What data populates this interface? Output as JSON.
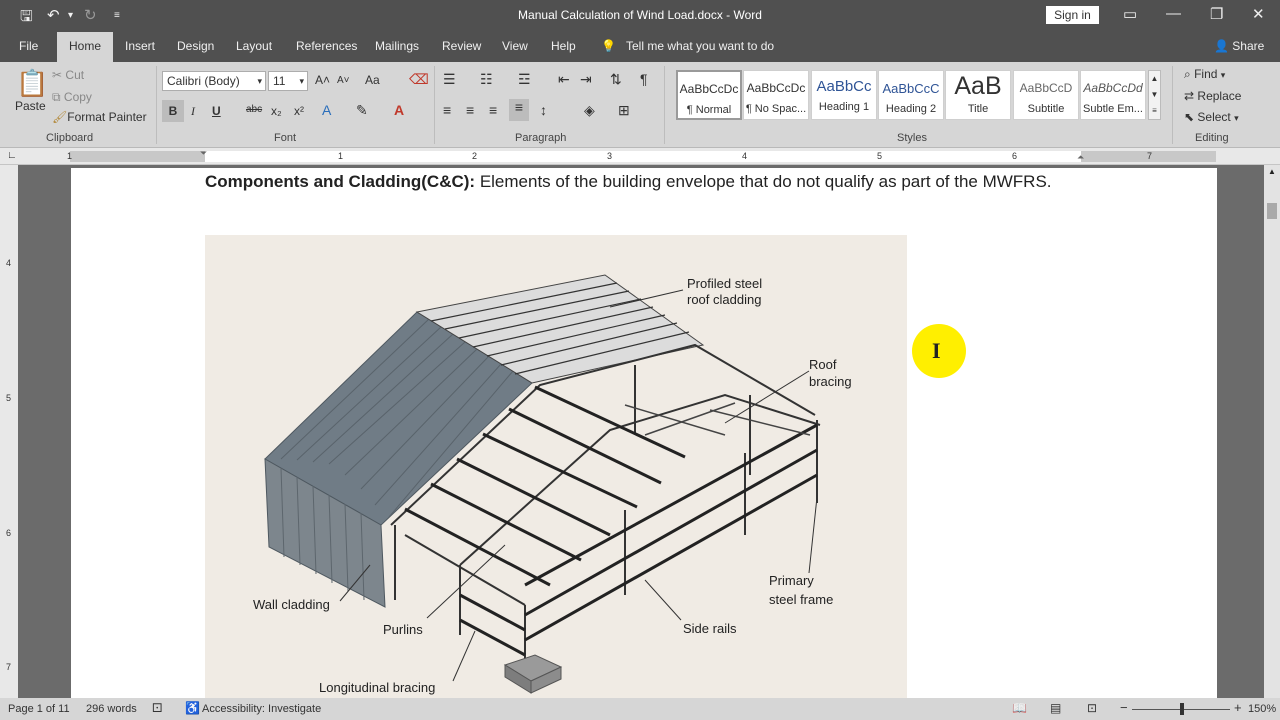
{
  "titlebar": {
    "save_icon": "save-icon",
    "undo_icon": "undo-icon",
    "redo_icon": "redo-icon",
    "title": "Manual Calculation of Wind Load.docx  -  Word",
    "signin": "Sign in"
  },
  "tabs": [
    "File",
    "Home",
    "Insert",
    "Design",
    "Layout",
    "References",
    "Mailings",
    "Review",
    "View",
    "Help",
    "Tell me what you want to do",
    "Share"
  ],
  "clipboard": {
    "paste": "Paste",
    "cut": "Cut",
    "copy": "Copy",
    "format_painter": "Format Painter",
    "group": "Clipboard"
  },
  "font": {
    "name": "Calibri (Body)",
    "size": "11",
    "group": "Font",
    "bold": "B",
    "italic": "I",
    "underline": "U",
    "strike": "abc",
    "sub": "x₂",
    "sup": "x²",
    "grow": "A˄",
    "shrink": "A˅",
    "case": "Aa"
  },
  "paragraph": {
    "group": "Paragraph"
  },
  "styles": {
    "group": "Styles",
    "items": [
      {
        "sample": "AaBbCcDc",
        "name": "¶ Normal"
      },
      {
        "sample": "AaBbCcDc",
        "name": "¶ No Spac..."
      },
      {
        "sample": "AaBbCc",
        "name": "Heading 1"
      },
      {
        "sample": "AaBbCcC",
        "name": "Heading 2"
      },
      {
        "sample": "AaB",
        "name": "Title"
      },
      {
        "sample": "AaBbCcD",
        "name": "Subtitle"
      },
      {
        "sample": "AaBbCcDd",
        "name": "Subtle Em..."
      }
    ]
  },
  "editing": {
    "find": "Find",
    "replace": "Replace",
    "select": "Select",
    "group": "Editing"
  },
  "ruler": {
    "numbers": [
      "1",
      "1",
      "2",
      "3",
      "4",
      "5",
      "6",
      "7"
    ],
    "vnumbers": [
      "4",
      "5",
      "6",
      "7"
    ]
  },
  "document": {
    "heading_bold": "Components and Cladding(C&C):",
    "heading_rest": " Elements of the building envelope that do not qualify as part of the MWFRS."
  },
  "figure": {
    "labels": [
      "Profiled steel",
      "roof cladding",
      "Roof",
      "bracing",
      "Primary",
      "steel frame",
      "Side rails",
      "Wall cladding",
      "Purlins",
      "Longitudinal bracing"
    ]
  },
  "statusbar": {
    "page": "Page 1 of 11",
    "words": "296 words",
    "accessibility": "Accessibility: Investigate",
    "zoom": "150%"
  },
  "colors": {
    "titlebar": "#505050",
    "ribbon": "#d6d6d6",
    "highlight": "#ffef00"
  }
}
